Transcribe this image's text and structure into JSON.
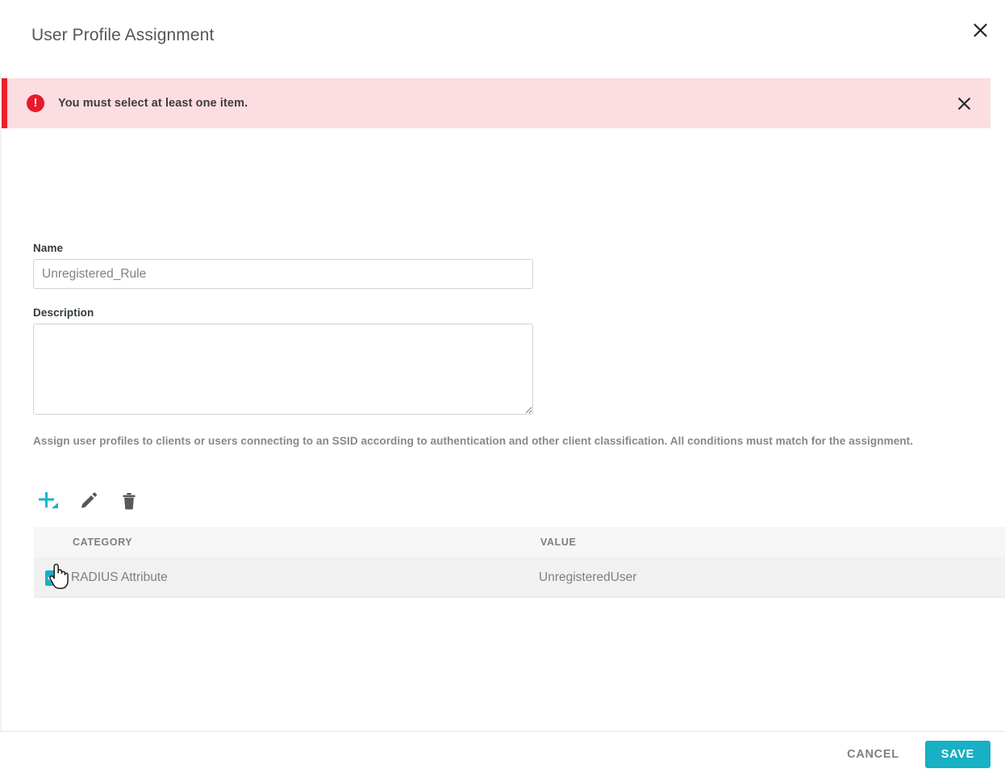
{
  "dialog": {
    "title": "User Profile Assignment",
    "close_icon": "close-icon"
  },
  "alert": {
    "icon": "error-icon",
    "symbol": "!",
    "message": "You must select at least one item.",
    "close_icon": "close-icon",
    "accent_color": "#f01e2b",
    "background_color": "#fcdde2",
    "icon_color": "#e8192c"
  },
  "form": {
    "name": {
      "label": "Name",
      "value": "Unregistered_Rule",
      "placeholder": ""
    },
    "description": {
      "label": "Description",
      "value": "",
      "placeholder": ""
    },
    "help_text": "Assign user profiles to clients or users connecting to an SSID according to authentication and other client classification. All conditions must match for the assignment."
  },
  "toolbar": {
    "add": {
      "name": "add-icon",
      "title": "Add",
      "color": "#17b6c9"
    },
    "edit": {
      "name": "edit-icon",
      "title": "Edit",
      "color": "#58595b"
    },
    "delete": {
      "name": "delete-icon",
      "title": "Delete",
      "color": "#58595b"
    }
  },
  "table": {
    "columns": [
      "CATEGORY",
      "VALUE"
    ],
    "rows": [
      {
        "selected": true,
        "category": "RADIUS Attribute",
        "value": "UnregisteredUser"
      }
    ],
    "checkbox_color": "#19b0c4"
  },
  "footer": {
    "cancel_label": "CANCEL",
    "save_label": "SAVE",
    "save_color": "#17b0c4"
  },
  "cursor": {
    "icon": "pointing-hand-cursor"
  }
}
